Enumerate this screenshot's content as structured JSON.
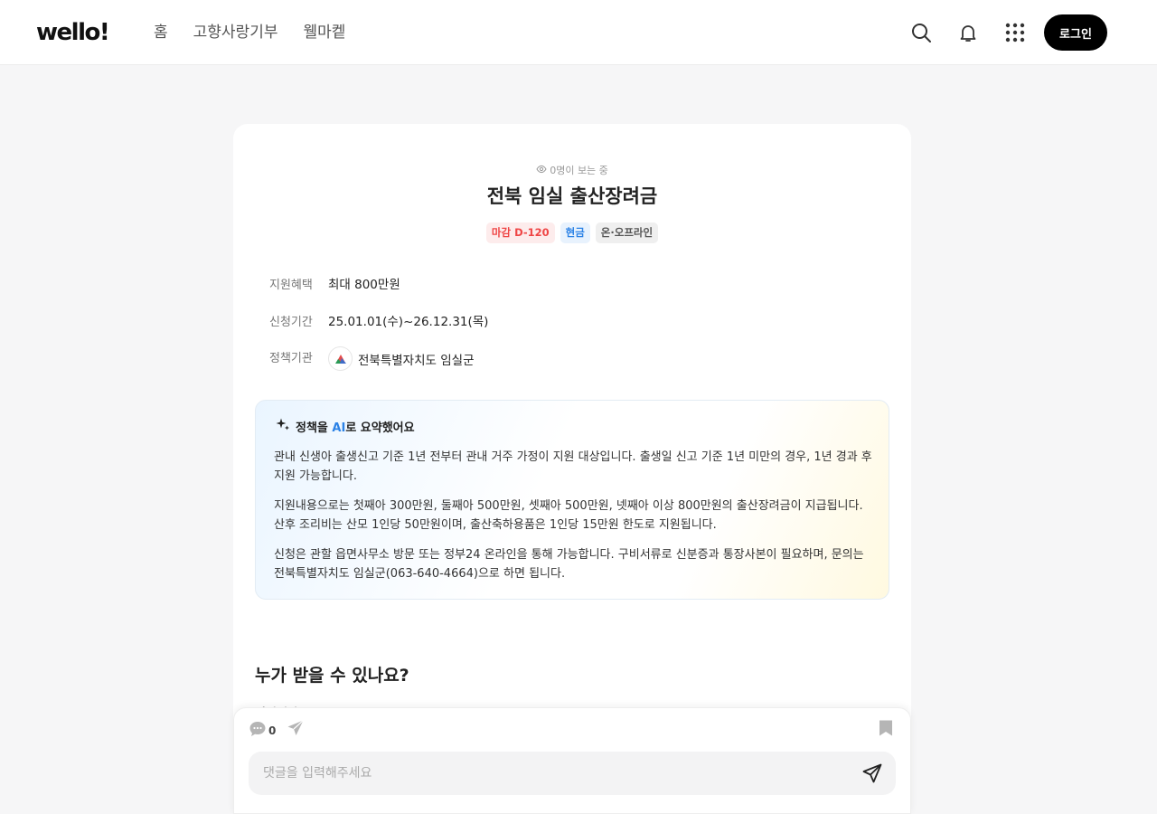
{
  "header": {
    "logo": "wello!",
    "nav": [
      "홈",
      "고향사랑기부",
      "웰마켙"
    ],
    "icons": [
      "search-icon",
      "bell-icon",
      "apps-grid-icon"
    ],
    "login_label": "로그인"
  },
  "policy": {
    "viewing": "0명이 보는 중",
    "title": "전북 임실 출산장려금",
    "badges": [
      {
        "label": "마감 D-120",
        "color": "#ef4545"
      },
      {
        "label": "현금",
        "color": "#2b82e6"
      },
      {
        "label": "온·오프라인",
        "color": "#555555"
      }
    ],
    "info": [
      {
        "label": "지원혜택",
        "value": "최대 800만원"
      },
      {
        "label": "신청기간",
        "value": "25.01.01(수)~26.12.31(목)"
      },
      {
        "label": "정책기관",
        "value": "전북특별자치도 임실군"
      }
    ]
  },
  "ai_summary": {
    "heading_pre": "정책을 ",
    "heading_ai": "AI",
    "heading_post": "로 요약했어요",
    "paragraphs": [
      "관내 신생아 출생신고 기준 1년 전부터 관내 거주 가정이 지원 대상입니다. 출생일 신고 기준 1년 미만의 경우, 1년 경과 후 지원 가능합니다.",
      "지원내용으로는 첫째아 300만원, 둘째아 500만원, 셋째아 500만원, 넷째아 이상 800만원의 출산장려금이 지급됩니다. 산후 조리비는 산모 1인당 50만원이며, 출산축하용품은 1인당 15만원 한도로 지원됩니다.",
      "신청은 관할 읍면사무소 방문 또는 정부24 온라인을 통해 가능합니다. 구비서류로 신분증과 통장사본이 필요하며, 문의는 전북특별자치도 임실군(063-640-4664)으로 하면 됩니다."
    ]
  },
  "section": {
    "title": "누가 받을 수 있나요?",
    "subtitle": "지원대상"
  },
  "bottom_bar": {
    "comment_count": "0",
    "comment_placeholder": "댓글을 입력해주세요"
  },
  "colors": {
    "accent": "#2b82e6",
    "deadline": "#ef4545",
    "button_bg": "#000000"
  }
}
